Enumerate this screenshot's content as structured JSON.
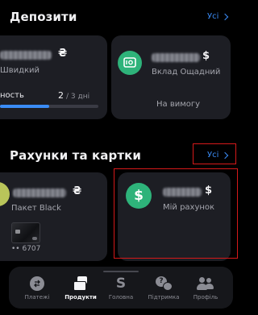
{
  "deposits": {
    "title": "Депозити",
    "all_label": "Усі",
    "card1": {
      "currency": "₴",
      "name": "Швидкий",
      "progress_label": "ность",
      "progress_value": "2",
      "progress_total": "/ 3 дні",
      "progress_fraction": 0.5
    },
    "card2": {
      "currency": "$",
      "name": "Вклад Ощадний",
      "term": "На вимогу",
      "icon": "safe-icon"
    }
  },
  "accounts": {
    "title": "Рахунки та картки",
    "all_label": "Усі",
    "card1": {
      "currency": "₴",
      "name": "Пакет Black",
      "card_last4": "•• 6707"
    },
    "card2": {
      "icon_symbol": "$",
      "currency": "$",
      "name": "Мій рахунок"
    }
  },
  "bottom_nav": {
    "items": [
      {
        "label": "Платежі",
        "icon": "payments-icon",
        "active": false
      },
      {
        "label": "Продукти",
        "icon": "products-icon",
        "active": true
      },
      {
        "label": "Головна",
        "icon": "home-s-icon",
        "active": false
      },
      {
        "label": "Підтримка",
        "icon": "support-icon",
        "active": false
      },
      {
        "label": "Профіль",
        "icon": "profile-icon",
        "active": false
      }
    ]
  },
  "colors": {
    "background": "#000000",
    "card": "#1d1e24",
    "accent_blue": "#3b8cf6",
    "green": "#2eb37a",
    "highlight_red": "#d6191a"
  }
}
